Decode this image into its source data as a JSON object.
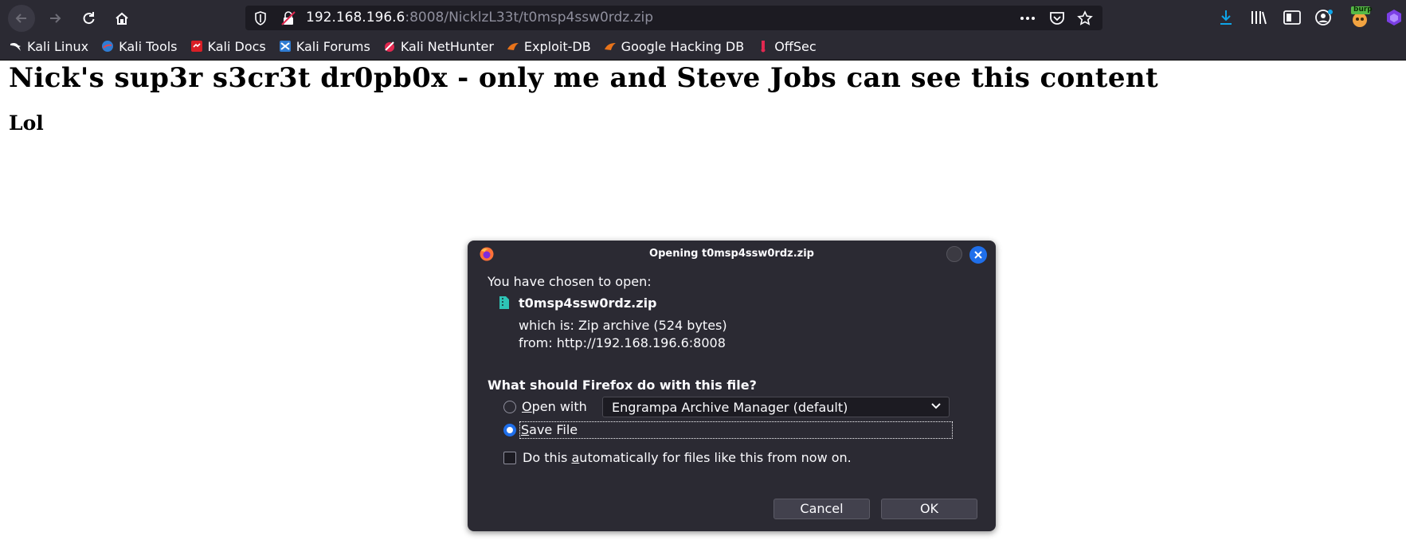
{
  "browser": {
    "url": {
      "host": "192.168.196.6",
      "rest": ":8008/NicklzL33t/t0msp4ssw0rdz.zip"
    },
    "toolbar_icons": [
      "download-icon",
      "library-icon",
      "sidebar-icon",
      "account-icon",
      "burp-extension-icon",
      "extension-icon"
    ],
    "burp_badge": "burp",
    "bookmarks": [
      {
        "label": "Kali Linux",
        "icon": "kali-dragon-icon"
      },
      {
        "label": "Kali Tools",
        "icon": "kali-tools-icon"
      },
      {
        "label": "Kali Docs",
        "icon": "kali-docs-icon"
      },
      {
        "label": "Kali Forums",
        "icon": "kali-forums-icon"
      },
      {
        "label": "Kali NetHunter",
        "icon": "nethunter-icon"
      },
      {
        "label": "Exploit-DB",
        "icon": "exploit-db-icon"
      },
      {
        "label": "Google Hacking DB",
        "icon": "ghdb-icon"
      },
      {
        "label": "OffSec",
        "icon": "offsec-icon"
      }
    ]
  },
  "page": {
    "heading": "Nick's sup3r s3cr3t dr0pb0x - only me and Steve Jobs can see this content",
    "subheading": "Lol"
  },
  "dialog": {
    "title": "Opening t0msp4ssw0rdz.zip",
    "intro": "You have chosen to open:",
    "filename": "t0msp4ssw0rdz.zip",
    "which_is_label": "which is:",
    "which_is_value": "Zip archive (524 bytes)",
    "from_label": "from:",
    "from_value": "http://192.168.196.6:8008",
    "question": "What should Firefox do with this file?",
    "open_with": {
      "mnemonic": "O",
      "rest": "pen with",
      "selected": false
    },
    "app_select": "Engrampa Archive Manager (default)",
    "save_file": {
      "mnemonic": "S",
      "rest": "ave File",
      "selected": true
    },
    "auto": {
      "before": "Do this ",
      "mnemonic": "a",
      "after": "utomatically for files like this from now on.",
      "checked": false
    },
    "cancel_label": "Cancel",
    "ok_label": "OK"
  },
  "colors": {
    "chrome_bg": "#2b2a33",
    "urlbar_bg": "#1c1b22",
    "accent": "#1f6feb",
    "download_icon": "#0ea5e9"
  }
}
